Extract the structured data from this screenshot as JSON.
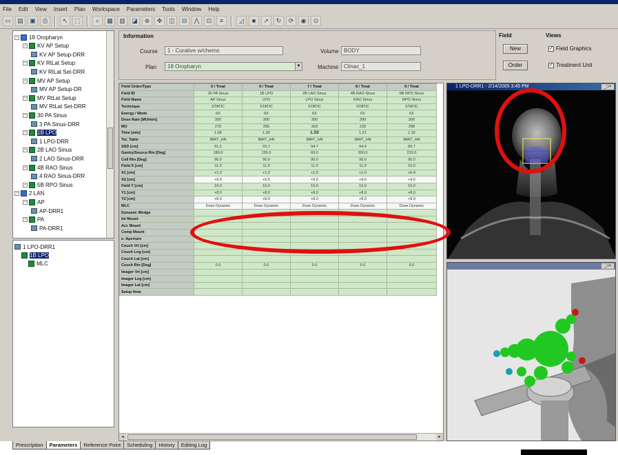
{
  "menu": [
    "File",
    "Edit",
    "View",
    "Insert",
    "Plan",
    "Workspace",
    "Parameters",
    "Tools",
    "Window",
    "Help"
  ],
  "toolbar_icons": [
    "new-icon",
    "open-icon",
    "save-icon",
    "print-icon",
    "cursor-icon",
    "select-icon",
    "zoom-icon",
    "grid-icon",
    "table-icon",
    "measure-icon",
    "zoom-in-icon",
    "pan-icon",
    "window-icon",
    "ruler-icon",
    "beam-icon",
    "field-icon",
    "mlc-icon",
    "wedge-icon",
    "block-icon",
    "arrow-icon",
    "rotate-icon",
    "refresh-icon",
    "camera-icon",
    "target-icon"
  ],
  "tree": {
    "items": [
      {
        "label": "18 Oropharyn",
        "kind": "plan"
      },
      {
        "label": "KV AP Setup",
        "kind": "field"
      },
      {
        "label": "KV AP Setup-DRR",
        "kind": "image"
      },
      {
        "label": "KV RtLat Setup",
        "kind": "field"
      },
      {
        "label": "KV RtLat Set-DRR",
        "kind": "image"
      },
      {
        "label": "MV AP Setup",
        "kind": "field"
      },
      {
        "label": "MV AP Setup-DR",
        "kind": "image"
      },
      {
        "label": "MV RtLat Setup",
        "kind": "field"
      },
      {
        "label": "MV RtLat Set-DRR",
        "kind": "image"
      },
      {
        "label": "30 PA Sinus",
        "kind": "field"
      },
      {
        "label": "3 PA Sinus-DRR",
        "kind": "image"
      },
      {
        "label": "1B LPO",
        "kind": "field",
        "selected": true
      },
      {
        "label": "1 LPO-DRR",
        "kind": "image"
      },
      {
        "label": "2B LAO Sinus",
        "kind": "field"
      },
      {
        "label": "2 LAO Sinus-DRR",
        "kind": "image"
      },
      {
        "label": "4B RAO Sinus",
        "kind": "field"
      },
      {
        "label": "4 RAO Sinus-DRR",
        "kind": "image"
      },
      {
        "label": "5B RPO Sinus",
        "kind": "field"
      },
      {
        "label": "2 LAN",
        "kind": "plan"
      },
      {
        "label": "AP",
        "kind": "field"
      },
      {
        "label": "AP-DRR1",
        "kind": "image"
      },
      {
        "label": "PA",
        "kind": "field"
      },
      {
        "label": "PA-DRR1",
        "kind": "image"
      }
    ],
    "bottom_items": [
      {
        "label": "1 LPO-DRR1"
      },
      {
        "label": "1B LPO"
      },
      {
        "label": "MLC"
      }
    ]
  },
  "information": {
    "title": "Information",
    "course_label": "Course",
    "course_value": "1 - Curative w/chemo",
    "plan_label": "Plan",
    "plan_value": "18 Oropharyn",
    "volume_label": "Volume",
    "volume_value": "BODY",
    "machine_label": "Machine",
    "machine_value": "Clinac_1"
  },
  "field_group": {
    "title": "Field",
    "new_label": "New",
    "order_label": "Order"
  },
  "views_group": {
    "title": "Views",
    "graphics_label": "Field Graphics",
    "treatment_label": "Treatment Unit"
  },
  "table": {
    "headers": [
      "Field Order/Type",
      "5 / Treat",
      "6 / Treat",
      "7 / Treat",
      "8 / Treat",
      "9 / Treat"
    ],
    "rows": [
      {
        "label": "Field ID",
        "values": [
          "30 PA Sinus",
          "1B LPO",
          "2B LAO Sinus",
          "4B RAO Sinus",
          "5B RPO Sinus"
        ]
      },
      {
        "label": "Field Name",
        "values": [
          "AP Sinus",
          "LPO",
          "LPO Sinus",
          "RAO Sinus",
          "RPO Sinus"
        ]
      },
      {
        "label": "Technique",
        "values": [
          "STATIC",
          "STATIC",
          "STATIC",
          "STATIC",
          "STATIC"
        ]
      },
      {
        "label": "Energy / Mode",
        "values": [
          "6X",
          "6X",
          "6X",
          "6X",
          "6X"
        ]
      },
      {
        "label": "Dose Rate [MU/min]",
        "values": [
          "300",
          "300",
          "300",
          "300",
          "300"
        ]
      },
      {
        "label": "MU",
        "values": [
          "279",
          "256",
          "303",
          "233",
          "288"
        ]
      },
      {
        "label": "Time [min]",
        "values": [
          "1.68",
          "1.20",
          "1.50",
          "1.21",
          "1.32"
        ],
        "bold_index": 2
      },
      {
        "label": "Tol. Table",
        "values": [
          "IMRT_HN",
          "IMRT_HN",
          "IMRT_HN",
          "IMRT_HN",
          "IMRT_HN"
        ]
      },
      {
        "label": "SSD [cm]",
        "values": [
          "91.2",
          "93.7",
          "94.7",
          "94.4",
          "90.7"
        ]
      },
      {
        "label": "Gantry/Source Rtn [Deg]",
        "values": [
          "180.0",
          "155.0",
          "60.0",
          "300.0",
          "210.0"
        ]
      },
      {
        "label": "Coll Rtn [Deg]",
        "values": [
          "90.0",
          "90.0",
          "90.0",
          "90.0",
          "90.0"
        ]
      },
      {
        "label": "Field X [cm]",
        "values": [
          "11.0",
          "11.0",
          "11.0",
          "11.0",
          "10.0"
        ]
      },
      {
        "label": "X1 [cm]",
        "values": [
          "+1.0",
          "+1.5",
          "+1.5",
          "+1.0",
          "+0.4"
        ]
      },
      {
        "label": "X2 [cm]",
        "values": [
          "+9.6",
          "+9.5",
          "+9.5",
          "+9.6",
          "+9.6"
        ],
        "white": true
      },
      {
        "label": "Field Y [cm]",
        "values": [
          "16.0",
          "16.0",
          "16.0",
          "16.0",
          "16.0"
        ]
      },
      {
        "label": "Y1 [cm]",
        "values": [
          "+8.0",
          "+8.0",
          "+8.0",
          "+8.0",
          "+8.0"
        ]
      },
      {
        "label": "Y2 [cm]",
        "values": [
          "+8.0",
          "+8.0",
          "+8.0",
          "+8.0",
          "+8.0"
        ],
        "white": true
      },
      {
        "label": "MLC",
        "values": [
          "Dose Dynamic",
          "Dose Dynamic",
          "Dose Dynamic",
          "Dose Dynamic",
          "Dose Dynamic"
        ],
        "white": true
      },
      {
        "label": "Dynamic Wedge",
        "values": [
          "",
          "",
          "",
          "",
          ""
        ]
      },
      {
        "label": "Int Mount",
        "values": [
          "",
          "",
          "",
          "",
          ""
        ]
      },
      {
        "label": "Acc Mount",
        "values": [
          "",
          "",
          "",
          "",
          ""
        ]
      },
      {
        "label": "Comp Mount",
        "values": [
          "",
          "",
          "",
          "",
          ""
        ]
      },
      {
        "label": "e- Aperture",
        "values": [
          "",
          "",
          "",
          "",
          ""
        ]
      },
      {
        "label": "Couch Vrt [cm]",
        "values": [
          "",
          "",
          "",
          "",
          ""
        ]
      },
      {
        "label": "Couch Lng [cm]",
        "values": [
          "",
          "",
          "",
          "",
          ""
        ]
      },
      {
        "label": "Couch Lat [cm]",
        "values": [
          "",
          "",
          "",
          "",
          ""
        ]
      },
      {
        "label": "Couch Rtn [Deg]",
        "values": [
          "0.0",
          "0.0",
          "0.0",
          "0.0",
          "0.0"
        ]
      },
      {
        "label": "Imager Vrt [cm]",
        "values": [
          "",
          "",
          "",
          "",
          ""
        ]
      },
      {
        "label": "Imager Lng [cm]",
        "values": [
          "",
          "",
          "",
          "",
          ""
        ]
      },
      {
        "label": "Imager Lat [cm]",
        "values": [
          "",
          "",
          "",
          "",
          ""
        ]
      },
      {
        "label": "Setup Note",
        "values": [
          "",
          "",
          "",
          "",
          ""
        ]
      }
    ]
  },
  "drr_view": {
    "title": "1 LPO-DRR1 - 2/14/2005 3:45 PM"
  },
  "view3d": {
    "title": ""
  },
  "tabs": [
    "Prescription",
    "Parameters",
    "Reference Point",
    "Scheduling",
    "History",
    "Editing Log"
  ],
  "active_tab": 1,
  "colors": {
    "cell_green": "#cfe8c8",
    "header_gray": "#c4cac4",
    "annotation_red": "#e01010",
    "selection_blue": "#0a246a"
  }
}
